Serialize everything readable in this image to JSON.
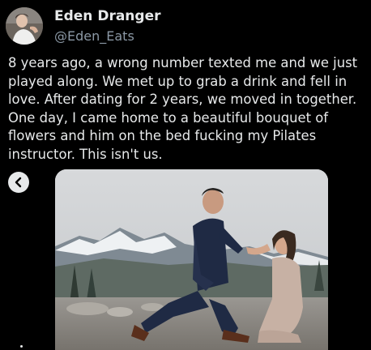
{
  "tweet": {
    "author_name": "Eden Dranger",
    "author_handle": "@Eden_Eats",
    "text_lines": [
      "8 years ago, a wrong number texted me and we just",
      "played along. We met up to grab a drink and fell in",
      "love. After dating for 2 years, we moved in together.",
      "One day, I came home to a beautiful bouquet of",
      "flowers and him on the bed fucking my Pilates",
      "instructor. This isn't us."
    ]
  },
  "media": {
    "icon": "chevron-left-icon"
  },
  "colors": {
    "background": "#000000",
    "text": "#e7e9ea",
    "secondary_text": "#8b98a5"
  }
}
